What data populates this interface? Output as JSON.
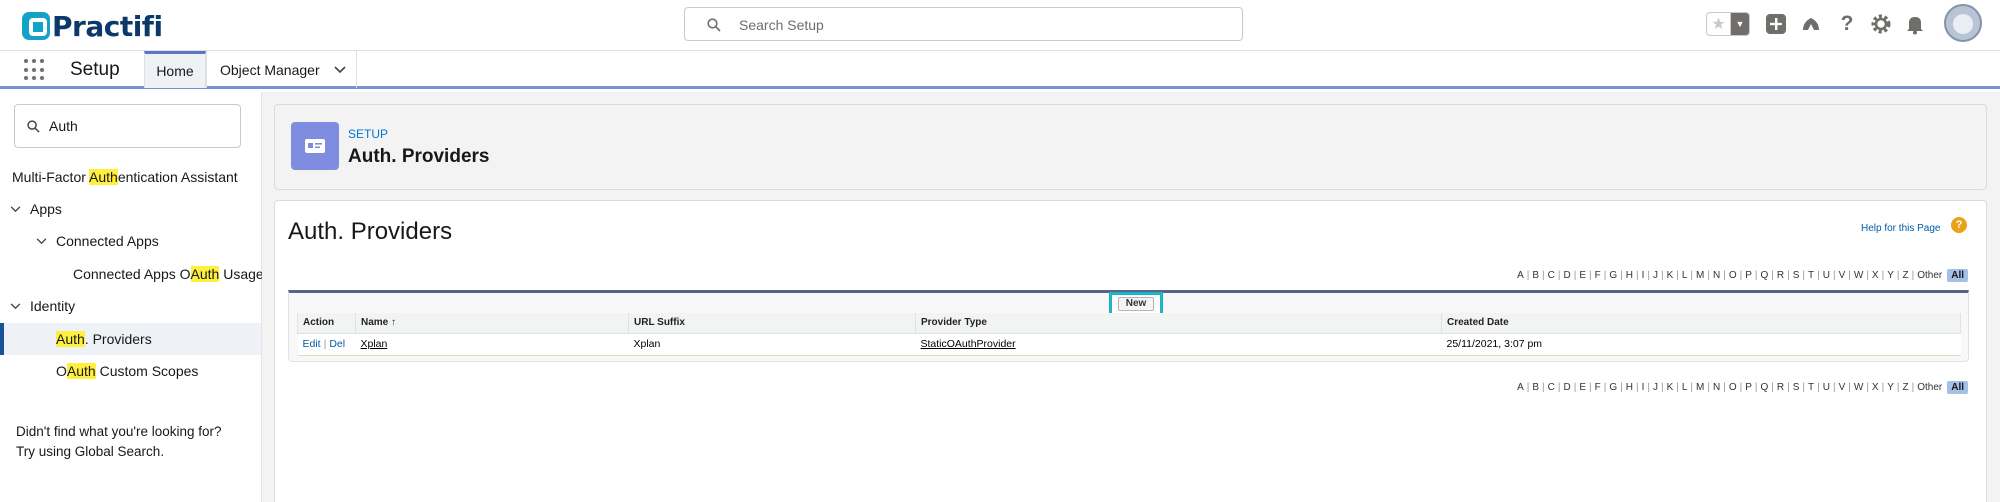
{
  "header": {
    "logo_text": "Practifi",
    "search_placeholder": "Search Setup"
  },
  "nav": {
    "app_name": "Setup",
    "tabs": [
      {
        "label": "Home"
      },
      {
        "label": "Object Manager"
      }
    ]
  },
  "sidebar": {
    "quick_find_value": "Auth",
    "items": [
      {
        "pre": "Multi-Factor ",
        "hl": "Auth",
        "post": "entication Assistant"
      },
      {
        "pre": "Apps",
        "hl": "",
        "post": ""
      },
      {
        "pre": "Connected Apps",
        "hl": "",
        "post": ""
      },
      {
        "pre": "Connected Apps O",
        "hl": "Auth",
        "post": " Usage"
      },
      {
        "pre": "Identity",
        "hl": "",
        "post": ""
      },
      {
        "pre": "",
        "hl": "Auth",
        "post": ". Providers"
      },
      {
        "pre": "O",
        "hl": "Auth",
        "post": " Custom Scopes"
      }
    ],
    "help_line1": "Didn't find what you're looking for?",
    "help_line2": "Try using Global Search."
  },
  "page_header": {
    "eyebrow": "SETUP",
    "title": "Auth. Providers"
  },
  "content": {
    "title": "Auth. Providers",
    "help_link": "Help for this Page",
    "new_button": "New",
    "alphabet": [
      "A",
      "B",
      "C",
      "D",
      "E",
      "F",
      "G",
      "H",
      "I",
      "J",
      "K",
      "L",
      "M",
      "N",
      "O",
      "P",
      "Q",
      "R",
      "S",
      "T",
      "U",
      "V",
      "W",
      "X",
      "Y",
      "Z",
      "Other"
    ],
    "alphabet_all": "All",
    "columns": [
      "Action",
      "Name",
      "URL Suffix",
      "Provider Type",
      "Created Date"
    ],
    "sort_indicator": "↑",
    "rows": [
      {
        "edit": "Edit",
        "del": "Del",
        "name": "Xplan",
        "url_suffix": "Xplan",
        "provider_type": "StaticOAuthProvider",
        "created": "25/11/2021, 3:07 pm"
      }
    ]
  },
  "colors": {
    "brand": "#14a3c7",
    "nav_accent": "#7a8fd6",
    "highlight": "#fff03f",
    "link": "#015ba7",
    "focus_ring": "#1fb3c9"
  }
}
